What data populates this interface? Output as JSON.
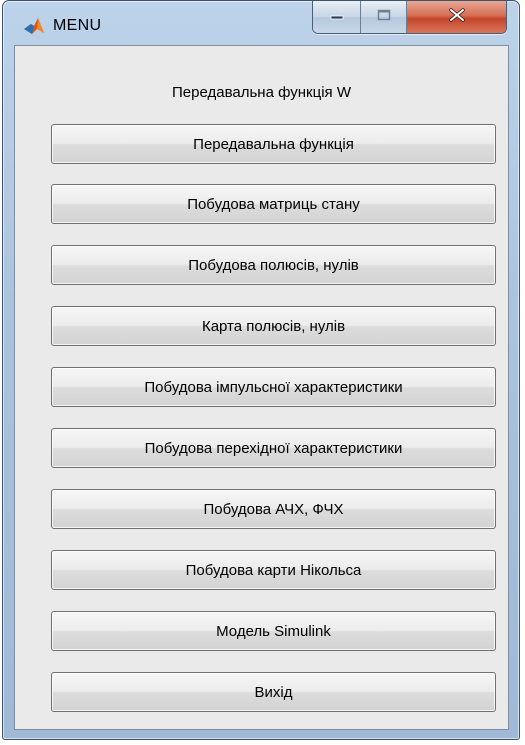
{
  "window": {
    "title": "MENU"
  },
  "panel": {
    "title": "Передавальна функція W"
  },
  "buttons": [
    "Передавальна функція",
    "Побудова матриць стану",
    "Побудова полюсів, нулів",
    "Карта полюсів, нулів",
    "Побудова імпульсної характеристики",
    "Побудова перехідної характеристики",
    "Побудова АЧХ, ФЧХ",
    "Побудова карти Нікольса",
    "Модель Simulink",
    "Вихід"
  ],
  "icons": {
    "app": "matlab-logo-icon",
    "minimize": "minimize-icon",
    "maximize": "maximize-icon",
    "close": "close-icon"
  },
  "colors": {
    "frame": "#a9c2dd",
    "client": "#eaeaea",
    "close": "#c4452a"
  }
}
